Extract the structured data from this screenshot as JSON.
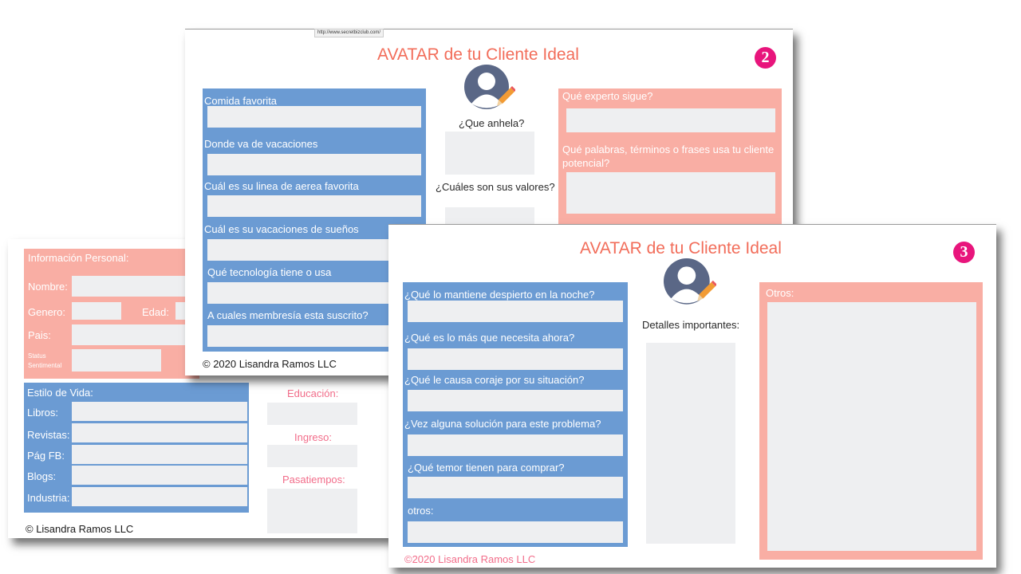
{
  "sheet1": {
    "personal_header": "Información Personal:",
    "nombre": "Nombre:",
    "genero": "Genero:",
    "edad": "Edad:",
    "pais": "Pais:",
    "status": "Status",
    "sentimental": "Sentimental",
    "estilo_header": "Estilo de Vida:",
    "libros": "Libros:",
    "revistas": "Revistas:",
    "pag_fb": "Pág FB:",
    "blogs": "Blogs:",
    "industria": "Industria:",
    "educacion": "Educación:",
    "ingreso": "Ingreso:",
    "pasatiempos": "Pasatiempos:",
    "footer": "© Lisandra Ramos LLC"
  },
  "sheet2": {
    "url": "http://www.secretbizclub.com/",
    "title": "AVATAR de tu Cliente Ideal",
    "badge": "2",
    "comida": "Comida favorita",
    "vacaciones": "Donde va de vacaciones",
    "linea_aerea": "Cuál es su linea de aerea favorita",
    "vacaciones_suenos": "Cuál es su vacaciones de sueños",
    "tecnologia": "Qué tecnología tiene o usa",
    "membresia": "A cuales membresía esta suscrito?",
    "anhela": "¿Que anhela?",
    "valores": "¿Cuáles son sus valores?",
    "experto": "Qué experto sigue?",
    "palabras": "Qué palabras, términos o frases usa tu cliente potencial?",
    "footer": "© 2020 Lisandra Ramos LLC"
  },
  "sheet3": {
    "title": "AVATAR de tu Cliente Ideal",
    "badge": "3",
    "q1": "¿Qué lo mantiene despierto en la noche?",
    "q2": "¿Qué es lo más que necesita ahora?",
    "q3": "¿Qué le causa coraje por su situación?",
    "q4": "¿Vez alguna solución para este problema?",
    "q5": "¿Qué temor tienen para comprar?",
    "q6": "otros:",
    "detalles": "Detalles importantes:",
    "otros": "Otros:",
    "footer": "©2020 Lisandra Ramos LLC"
  },
  "icons": [
    "user-avatar-icon",
    "pencil-icon"
  ],
  "colors": {
    "blue_panel": "#6b9bd3",
    "pink_panel": "#f9aea4",
    "title": "#f26d5a",
    "badge": "#e8157c",
    "field": "#eeeff1"
  }
}
